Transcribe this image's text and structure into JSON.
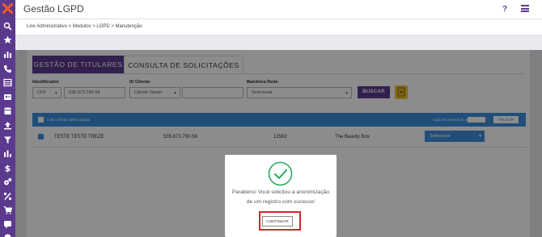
{
  "app": {
    "title": "Gestão LGPD"
  },
  "header": {
    "help_label": "?"
  },
  "breadcrumb": {
    "text": "Linx Administrativo  >  Modulos  >  LGPD  >  Manutenção"
  },
  "tabs": [
    {
      "label": "GESTÃO DE TITULARES",
      "active": true
    },
    {
      "label": "CONSULTA DE SOLICITAÇÕES",
      "active": false
    }
  ],
  "filters": {
    "identificador": {
      "label": "Identificador",
      "type_value": "CPF",
      "value": "535.673.750-58"
    },
    "id_cliente": {
      "label": "ID Cliente",
      "type_value": "Cliente Varejo",
      "value": ""
    },
    "bandeira": {
      "label": "Bandeira Rede",
      "value": "Selecionar"
    },
    "search_button": "BUSCAR"
  },
  "results": {
    "count_text": "1 de 1 linhas selecionadas",
    "bulk_label": "Ação em massa de anonimizar:",
    "apply_button": "APLICAR",
    "rows": [
      {
        "name": "TESTE TESTE TREZE",
        "cpf": "535.673.750-58",
        "id": "12562",
        "brand": "The Beauty Box",
        "action": "Selecionar",
        "checked": true
      }
    ]
  },
  "modal": {
    "message": "Parabéns! Você solicitou a anonimização de um registro com sucesso!",
    "button": "CONTINUAR"
  },
  "colors": {
    "brand": "#5b3a8e",
    "accent": "#3d8fdc",
    "success": "#27a95e",
    "highlight": "#d8232a"
  },
  "sidebar_icons": [
    "linx-logo-icon",
    "search-icon",
    "star-icon",
    "bar-chart-icon",
    "phone-icon",
    "table-icon",
    "id-card-icon",
    "store-icon",
    "upload-icon",
    "filter-icon",
    "bar-chart-icon",
    "dollar-icon",
    "gears-icon",
    "percent-icon",
    "cart-icon",
    "chat-icon",
    "settings-icon"
  ]
}
